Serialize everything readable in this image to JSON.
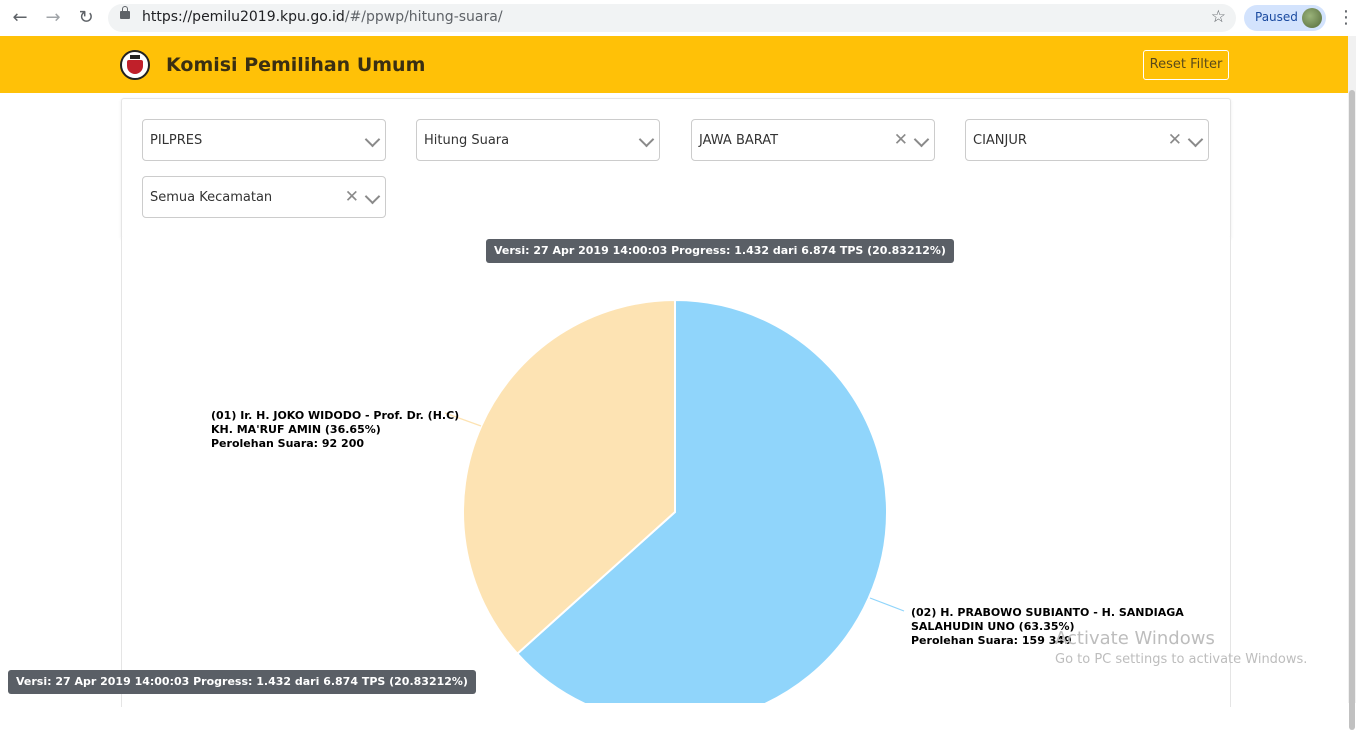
{
  "browser": {
    "url_host": "https://pemilu2019.kpu.go.id",
    "url_path": "/#/ppwp/hitung-suara/",
    "paused_label": "Paused"
  },
  "header": {
    "title": "Komisi Pemilihan Umum",
    "reset_label": "Reset Filter",
    "accent_color": "#ffc107"
  },
  "filters": [
    {
      "value": "PILPRES",
      "clearable": false
    },
    {
      "value": "Hitung Suara",
      "clearable": false
    },
    {
      "value": "JAWA BARAT",
      "clearable": true
    },
    {
      "value": "CIANJUR",
      "clearable": true
    },
    {
      "value": "Semua Kecamatan",
      "clearable": true
    }
  ],
  "version_text": "Versi: 27 Apr 2019 14:00:03 Progress: 1.432 dari 6.874 TPS (20.83212%)",
  "watermark": {
    "title": "Activate Windows",
    "subtitle": "Go to PC settings to activate Windows."
  },
  "chart_data": {
    "type": "pie",
    "slices": [
      {
        "label_lines": [
          "(01) Ir. H. JOKO WIDODO - Prof. Dr. (H.C)",
          "KH. MA'RUF AMIN (36.65%)",
          "Perolehan Suara: 92 200"
        ],
        "percent": 36.65,
        "value": 92200,
        "color": "#fde3b3"
      },
      {
        "label_lines": [
          "(02) H. PRABOWO SUBIANTO - H. SANDIAGA",
          "SALAHUDIN UNO (63.35%)",
          "Perolehan Suara: 159 349"
        ],
        "percent": 63.35,
        "value": 159349,
        "color": "#90d5fb"
      }
    ]
  }
}
